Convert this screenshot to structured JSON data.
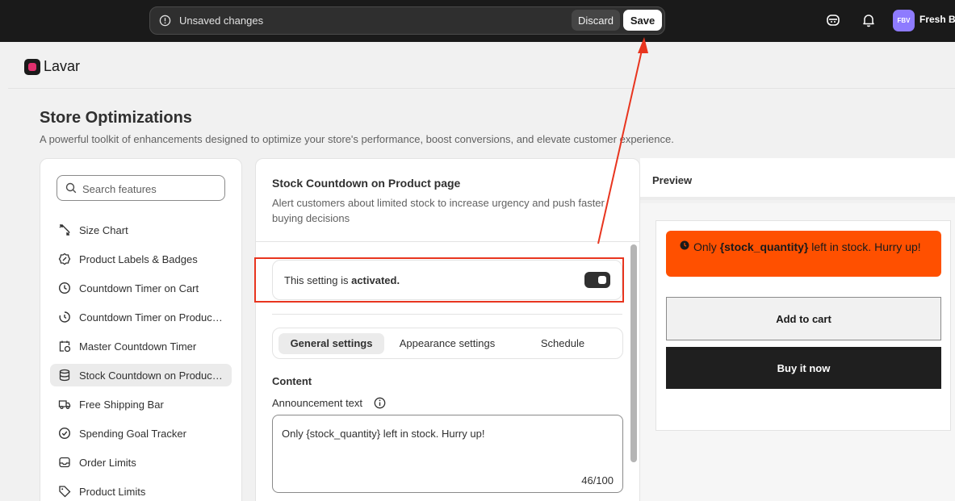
{
  "topbar": {
    "unsaved_message": "Unsaved changes",
    "discard_label": "Discard",
    "save_label": "Save",
    "avatar_initials": "FBV",
    "store_name": "Fresh Bl"
  },
  "app": {
    "name": "Lavar"
  },
  "page": {
    "title": "Store Optimizations",
    "subtitle": "A powerful toolkit of enhancements designed to optimize your store's performance, boost conversions, and elevate customer experience."
  },
  "sidebar": {
    "search_placeholder": "Search features",
    "items": [
      {
        "label": "Size Chart",
        "icon": "ruler-icon"
      },
      {
        "label": "Product Labels & Badges",
        "icon": "badge-icon"
      },
      {
        "label": "Countdown Timer on Cart",
        "icon": "clock-icon"
      },
      {
        "label": "Countdown Timer on Product page",
        "icon": "timer-icon"
      },
      {
        "label": "Master Countdown Timer",
        "icon": "calendar-clock-icon"
      },
      {
        "label": "Stock Countdown on Product page",
        "icon": "database-icon",
        "active": true
      },
      {
        "label": "Free Shipping Bar",
        "icon": "truck-icon"
      },
      {
        "label": "Spending Goal Tracker",
        "icon": "check-circle-icon"
      },
      {
        "label": "Order Limits",
        "icon": "inbox-icon"
      },
      {
        "label": "Product Limits",
        "icon": "tag-icon"
      }
    ]
  },
  "settings": {
    "title": "Stock Countdown on Product page",
    "description": "Alert customers about limited stock to increase urgency and push faster buying decisions",
    "activation_prefix": "This setting is ",
    "activation_status": "activated.",
    "tabs": [
      "General settings",
      "Appearance settings",
      "Schedule"
    ],
    "content_heading": "Content",
    "announcement_label": "Announcement text",
    "announcement_value": "Only {stock_quantity} left in stock. Hurry up!",
    "char_count": "46/100"
  },
  "preview": {
    "title": "Preview",
    "banner_prefix": "Only ",
    "banner_variable": "{stock_quantity}",
    "banner_suffix": " left in stock. Hurry up!",
    "add_to_cart": "Add to cart",
    "buy_now": "Buy it now"
  },
  "colors": {
    "banner": "#ff5000",
    "highlight": "#e8351f",
    "topbar": "#1a1a1a"
  }
}
